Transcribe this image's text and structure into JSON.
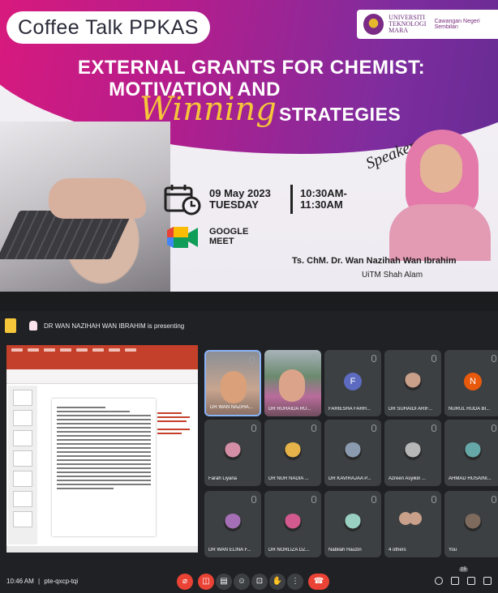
{
  "poster": {
    "series_title": "Coffee Talk PPKAS",
    "university": "UNIVERSITI TEKNOLOGI MARA",
    "campus": "Cawangan Negeri Sembilan",
    "title_line1": "EXTERNAL GRANTS FOR CHEMIST:",
    "title_line2": "MOTIVATION AND",
    "title_script": "Winning",
    "title_line3": "STRATEGIES",
    "speaker_word": "Speaker",
    "date": "09 May 2023",
    "day": "TUESDAY",
    "time_start": "10:30AM-",
    "time_end": "11:30AM",
    "platform_line1": "GOOGLE",
    "platform_line2": "MEET",
    "speaker_name": "Ts. ChM. Dr. Wan Nazihah Wan Ibrahim",
    "speaker_affiliation": "UiTM Shah Alam"
  },
  "meet": {
    "presenting_text": "DR WAN NAZIHAH WAN IBRAHIM is presenting",
    "time": "10:46 AM",
    "meeting_code": "pte-qxcp-tqi",
    "participants": [
      {
        "name": "DR WAN NAZIHA...",
        "type": "video1"
      },
      {
        "name": "DR RUHAIDA RU...",
        "type": "video2"
      },
      {
        "name": "FARIESHA FARH...",
        "type": "letter",
        "letter": "F",
        "color": "#5c6bc0"
      },
      {
        "name": "DR SUHAIDI ARIF...",
        "type": "photo",
        "color": "#c9a08a"
      },
      {
        "name": "NURUL HUDA BI...",
        "type": "letter",
        "letter": "N",
        "color": "#e8590c"
      },
      {
        "name": "Farah Liyana",
        "type": "photo",
        "color": "#d48fa7"
      },
      {
        "name": "DR NUR NADIA ...",
        "type": "photo",
        "color": "#e6b34a"
      },
      {
        "name": "DR KAVIRAJAA P...",
        "type": "photo",
        "color": "#8a9bb0"
      },
      {
        "name": "Azreen Asyikin ...",
        "type": "photo",
        "color": "#b7b7b7"
      },
      {
        "name": "AHMAD HUSAINI...",
        "type": "photo",
        "color": "#66a8a8"
      },
      {
        "name": "DR WAN ELINA F...",
        "type": "photo",
        "color": "#a56fb5"
      },
      {
        "name": "DR NORLIZA DZ...",
        "type": "photo",
        "color": "#d35a8e"
      },
      {
        "name": "Nabilah Hauzin",
        "type": "photo",
        "color": "#9ad0c2"
      },
      {
        "name": "4 others",
        "type": "others",
        "color": "#c9a08a"
      },
      {
        "name": "You",
        "type": "photo",
        "color": "#7f6a5e"
      }
    ],
    "controls": [
      "mic-off-icon",
      "camera-off-icon",
      "captions-icon",
      "emoji-icon",
      "present-icon",
      "raise-hand-icon",
      "more-icon",
      "hang-up-icon"
    ],
    "side_count": "15"
  }
}
